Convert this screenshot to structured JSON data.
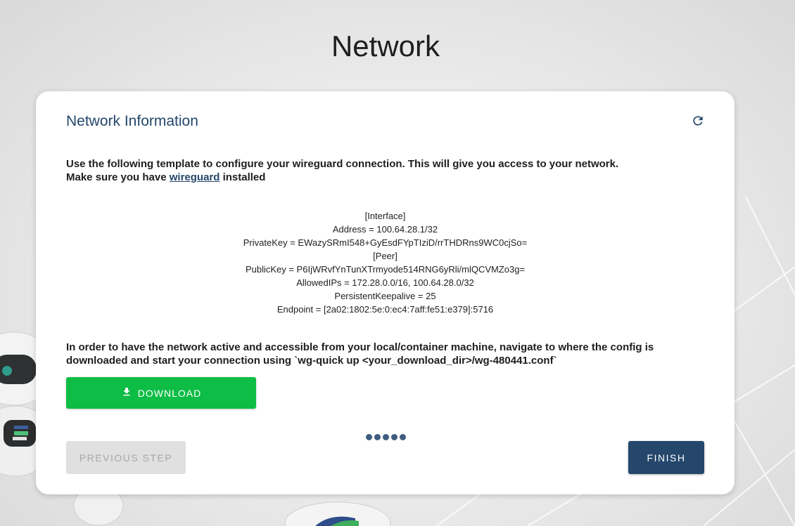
{
  "page": {
    "title": "Network"
  },
  "card": {
    "title": "Network Information",
    "refresh_icon": "refresh-icon",
    "intro_line1": "Use the following template to configure your wireguard connection. This will give you access to your network.",
    "intro_line2_prefix": "Make sure you have ",
    "intro_link": "wireguard",
    "intro_line2_suffix": " installed",
    "config_lines": [
      "[Interface]",
      "Address = 100.64.28.1/32",
      "PrivateKey = EWazySRmI548+GyEsdFYpTIziD/rrTHDRns9WC0cjSo=",
      "[Peer]",
      "PublicKey = P6IjWRvfYnTunXTrmyode514RNG6yRli/mlQCVMZo3g=",
      "AllowedIPs = 172.28.0.0/16, 100.64.28.0/32",
      "PersistentKeepalive = 25",
      "Endpoint = [2a02:1802:5e:0:ec4:7aff:fe51:e379]:5716"
    ],
    "instructions": "In order to have the network active and accessible from your local/container machine, navigate to where the config is downloaded and start your connection using `wg-quick up <your_download_dir>/wg-480441.conf`",
    "download_label": "DOWNLOAD",
    "download_icon": "download-icon",
    "progress_dots": 5,
    "previous_label": "PREVIOUS STEP",
    "finish_label": "FINISH"
  },
  "colors": {
    "primary": "#24476b",
    "download": "#0ebd45",
    "disabled": "#e0e0e0"
  }
}
